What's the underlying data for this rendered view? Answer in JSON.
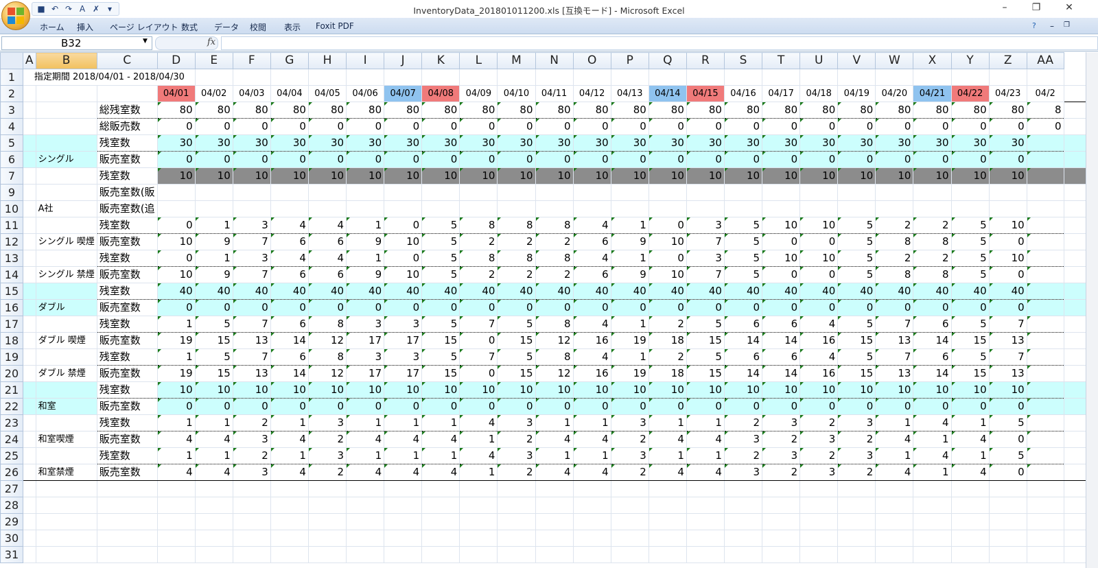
{
  "window": {
    "title": "InventoryData_201801011200.xls [互換モード] - Microsoft Excel"
  },
  "ribbon": {
    "tabs": [
      "ホーム",
      "挿入",
      "ページ レイアウト",
      "数式",
      "データ",
      "校閲",
      "表示",
      "Foxit PDF"
    ]
  },
  "name_box": "B32",
  "fx_label": "fx",
  "columns": [
    "A",
    "B",
    "C",
    "D",
    "E",
    "F",
    "G",
    "H",
    "I",
    "J",
    "K",
    "L",
    "M",
    "N",
    "O",
    "P",
    "Q",
    "R",
    "S",
    "T",
    "U",
    "V",
    "W",
    "X",
    "Y",
    "Z",
    "AA"
  ],
  "row_numbers": [
    "1",
    "2",
    "3",
    "4",
    "5",
    "6",
    "7",
    "9",
    "10",
    "11",
    "12",
    "13",
    "14",
    "15",
    "16",
    "17",
    "18",
    "19",
    "20",
    "21",
    "22",
    "23",
    "24",
    "25",
    "26",
    "27",
    "28",
    "29",
    "30",
    "31"
  ],
  "period_label": "指定期間 2018/04/01 - 2018/04/30",
  "dates": [
    "04/01",
    "04/02",
    "04/03",
    "04/04",
    "04/05",
    "04/06",
    "04/07",
    "04/08",
    "04/09",
    "04/10",
    "04/11",
    "04/12",
    "04/13",
    "04/14",
    "04/15",
    "04/16",
    "04/17",
    "04/18",
    "04/19",
    "04/20",
    "04/21",
    "04/22",
    "04/23",
    "04/2"
  ],
  "holidays": [
    "04/01",
    "04/08",
    "04/15",
    "04/22"
  ],
  "saturdays": [
    "04/07",
    "04/14",
    "04/21"
  ],
  "groups": {
    "single": "シングル",
    "company_a": "A社",
    "single_smoking": "シングル 喫煙",
    "single_nonsmoking": "シングル 禁煙",
    "double": "ダブル",
    "double_smoking": "ダブル 喫煙",
    "double_nonsmoking": "ダブル 禁煙",
    "japanese": "和室",
    "japanese_smoking": "和室喫煙",
    "japanese_nonsmoking": "和室禁煙"
  },
  "labels": {
    "total_remaining": "総残室数",
    "total_sold": "総販売数",
    "remaining": "残室数",
    "sold": "販売室数",
    "sold_a": "販売室数(販",
    "sold_b": "販売室数(追"
  },
  "values": {
    "total_remaining": [
      80,
      80,
      80,
      80,
      80,
      80,
      80,
      80,
      80,
      80,
      80,
      80,
      80,
      80,
      80,
      80,
      80,
      80,
      80,
      80,
      80,
      80,
      80,
      8
    ],
    "total_sold": [
      0,
      0,
      0,
      0,
      0,
      0,
      0,
      0,
      0,
      0,
      0,
      0,
      0,
      0,
      0,
      0,
      0,
      0,
      0,
      0,
      0,
      0,
      0,
      0
    ],
    "single_remaining": [
      30,
      30,
      30,
      30,
      30,
      30,
      30,
      30,
      30,
      30,
      30,
      30,
      30,
      30,
      30,
      30,
      30,
      30,
      30,
      30,
      30,
      30,
      30,
      ""
    ],
    "single_sold": [
      0,
      0,
      0,
      0,
      0,
      0,
      0,
      0,
      0,
      0,
      0,
      0,
      0,
      0,
      0,
      0,
      0,
      0,
      0,
      0,
      0,
      0,
      0,
      ""
    ],
    "company_a_remaining": [
      10,
      10,
      10,
      10,
      10,
      10,
      10,
      10,
      10,
      10,
      10,
      10,
      10,
      10,
      10,
      10,
      10,
      10,
      10,
      10,
      10,
      10,
      10,
      ""
    ],
    "single_smoking_remaining": [
      0,
      1,
      3,
      4,
      4,
      1,
      0,
      5,
      8,
      8,
      8,
      4,
      1,
      0,
      3,
      5,
      10,
      10,
      5,
      2,
      2,
      5,
      10,
      ""
    ],
    "single_smoking_sold": [
      10,
      9,
      7,
      6,
      6,
      9,
      10,
      5,
      2,
      2,
      2,
      6,
      9,
      10,
      7,
      5,
      0,
      0,
      5,
      8,
      8,
      5,
      0,
      ""
    ],
    "single_nonsmoking_remaining": [
      0,
      1,
      3,
      4,
      4,
      1,
      0,
      5,
      8,
      8,
      8,
      4,
      1,
      0,
      3,
      5,
      10,
      10,
      5,
      2,
      2,
      5,
      10,
      ""
    ],
    "single_nonsmoking_sold": [
      10,
      9,
      7,
      6,
      6,
      9,
      10,
      5,
      2,
      2,
      2,
      6,
      9,
      10,
      7,
      5,
      0,
      0,
      5,
      8,
      8,
      5,
      0,
      ""
    ],
    "double_remaining": [
      40,
      40,
      40,
      40,
      40,
      40,
      40,
      40,
      40,
      40,
      40,
      40,
      40,
      40,
      40,
      40,
      40,
      40,
      40,
      40,
      40,
      40,
      40,
      ""
    ],
    "double_sold": [
      0,
      0,
      0,
      0,
      0,
      0,
      0,
      0,
      0,
      0,
      0,
      0,
      0,
      0,
      0,
      0,
      0,
      0,
      0,
      0,
      0,
      0,
      0,
      ""
    ],
    "double_smoking_remaining": [
      1,
      5,
      7,
      6,
      8,
      3,
      3,
      5,
      7,
      5,
      8,
      4,
      1,
      2,
      5,
      6,
      6,
      4,
      5,
      7,
      6,
      5,
      7,
      ""
    ],
    "double_smoking_sold": [
      19,
      15,
      13,
      14,
      12,
      17,
      17,
      15,
      0,
      15,
      12,
      16,
      19,
      18,
      15,
      14,
      14,
      16,
      15,
      13,
      14,
      15,
      13,
      ""
    ],
    "double_nonsmoking_remaining": [
      1,
      5,
      7,
      6,
      8,
      3,
      3,
      5,
      7,
      5,
      8,
      4,
      1,
      2,
      5,
      6,
      6,
      4,
      5,
      7,
      6,
      5,
      7,
      ""
    ],
    "double_nonsmoking_sold": [
      19,
      15,
      13,
      14,
      12,
      17,
      17,
      15,
      0,
      15,
      12,
      16,
      19,
      18,
      15,
      14,
      14,
      16,
      15,
      13,
      14,
      15,
      13,
      ""
    ],
    "japanese_remaining": [
      10,
      10,
      10,
      10,
      10,
      10,
      10,
      10,
      10,
      10,
      10,
      10,
      10,
      10,
      10,
      10,
      10,
      10,
      10,
      10,
      10,
      10,
      10,
      ""
    ],
    "japanese_sold": [
      0,
      0,
      0,
      0,
      0,
      0,
      0,
      0,
      0,
      0,
      0,
      0,
      0,
      0,
      0,
      0,
      0,
      0,
      0,
      0,
      0,
      0,
      0,
      ""
    ],
    "japanese_smoking_remaining": [
      1,
      1,
      2,
      1,
      3,
      1,
      1,
      1,
      4,
      3,
      1,
      1,
      3,
      1,
      1,
      2,
      3,
      2,
      3,
      1,
      4,
      1,
      5,
      ""
    ],
    "japanese_smoking_sold": [
      4,
      4,
      3,
      4,
      2,
      4,
      4,
      4,
      1,
      2,
      4,
      4,
      2,
      4,
      4,
      3,
      2,
      3,
      2,
      4,
      1,
      4,
      0,
      ""
    ],
    "japanese_nonsmoking_remaining": [
      1,
      1,
      2,
      1,
      3,
      1,
      1,
      1,
      4,
      3,
      1,
      1,
      3,
      1,
      1,
      2,
      3,
      2,
      3,
      1,
      4,
      1,
      5,
      ""
    ],
    "japanese_nonsmoking_sold": [
      4,
      4,
      3,
      4,
      2,
      4,
      4,
      4,
      1,
      2,
      4,
      4,
      2,
      4,
      4,
      3,
      2,
      3,
      2,
      4,
      1,
      4,
      0,
      ""
    ]
  },
  "colors": {
    "holiday": "#f07a7a",
    "saturday": "#8fc3ef",
    "subtotal_row": "#ccfefd",
    "company_row": "#8c8c8c"
  }
}
